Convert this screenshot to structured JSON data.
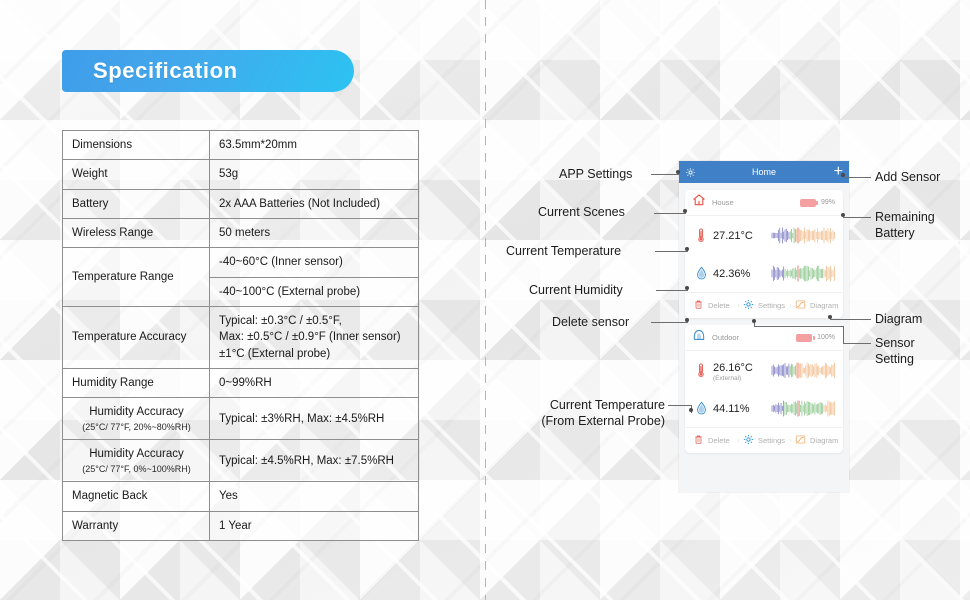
{
  "banner": {
    "title": "Specification"
  },
  "spec_table": {
    "rows": [
      {
        "key": "Dimensions",
        "key_center": false,
        "values": [
          "63.5mm*20mm"
        ]
      },
      {
        "key": "Weight",
        "key_center": false,
        "values": [
          "53g"
        ]
      },
      {
        "key": "Battery",
        "key_center": false,
        "values": [
          "2x AAA Batteries  (Not Included)"
        ]
      },
      {
        "key": "Wireless Range",
        "key_center": false,
        "values": [
          "50 meters"
        ]
      },
      {
        "key": "Temperature Range",
        "key_center": false,
        "values": [
          "-40~60°C (Inner sensor)",
          "-40~100°C (External probe)"
        ]
      },
      {
        "key": "Temperature  Accuracy",
        "key_center": false,
        "values": [
          "Typical: ±0.3°C / ±0.5°F,\nMax: ±0.5°C / ±0.9°F (Inner sensor)\n±1°C (External probe)"
        ]
      },
      {
        "key": "Humidity Range",
        "key_center": false,
        "values": [
          "0~99%RH"
        ]
      },
      {
        "key": "Humidity Accuracy",
        "key_sub": "(25°C/ 77°F, 20%~80%RH)",
        "key_center": true,
        "values": [
          "Typical: ±3%RH, Max: ±4.5%RH"
        ]
      },
      {
        "key": "Humidity Accuracy",
        "key_sub": "(25°C/ 77°F, 0%~100%RH)",
        "key_center": true,
        "values": [
          "Typical: ±4.5%RH, Max: ±7.5%RH"
        ]
      },
      {
        "key": "Magnetic Back",
        "key_center": false,
        "values": [
          "Yes"
        ]
      },
      {
        "key": "Warranty",
        "key_center": false,
        "values": [
          "1 Year"
        ]
      }
    ]
  },
  "phone": {
    "header": {
      "title": "Home",
      "settings_icon": "gear-icon",
      "add_icon": "plus-icon"
    },
    "cards": [
      {
        "scene_name": "House",
        "scene_icon": "house-icon",
        "battery": "99%",
        "temperature": "27.21°C",
        "temperature_sub": "",
        "humidity": "42.36%",
        "actions": [
          {
            "label": "Delete",
            "icon": "trash-icon"
          },
          {
            "label": "Settings",
            "icon": "gear-icon"
          },
          {
            "label": "Diagram",
            "icon": "chart-icon"
          }
        ]
      },
      {
        "scene_name": "Outdoor",
        "scene_icon": "tent-icon",
        "battery": "100%",
        "temperature": "26.16°C",
        "temperature_sub": "(External)",
        "humidity": "44.11%",
        "actions": [
          {
            "label": "Delete",
            "icon": "trash-icon"
          },
          {
            "label": "Settings",
            "icon": "gear-icon"
          },
          {
            "label": "Diagram",
            "icon": "chart-icon"
          }
        ]
      }
    ]
  },
  "callouts": {
    "left": [
      {
        "text": "APP Settings"
      },
      {
        "text": "Current  Scenes"
      },
      {
        "text": "Current Temperature"
      },
      {
        "text": "Current Humidity"
      },
      {
        "text": "Delete sensor"
      },
      {
        "line1": "Current Temperature",
        "line2": "(From External  Probe)"
      }
    ],
    "right": [
      {
        "line1": "Add Sensor",
        "line2": ""
      },
      {
        "line1": "Remaining",
        "line2": "Battery"
      },
      {
        "line1": "Diagram",
        "line2": ""
      },
      {
        "line1": "Sensor",
        "line2": "Setting"
      }
    ]
  },
  "colors": {
    "banner_from": "#3f9de9",
    "banner_to": "#2cc3f2",
    "header_blue": "#3f80c6",
    "battery_red": "#f4a0a0",
    "thermo_red": "#e8544a",
    "droplet_blue": "#3d8fd0",
    "gear_blue": "#2f9ad8",
    "diagram_orange": "#f0a15a"
  }
}
